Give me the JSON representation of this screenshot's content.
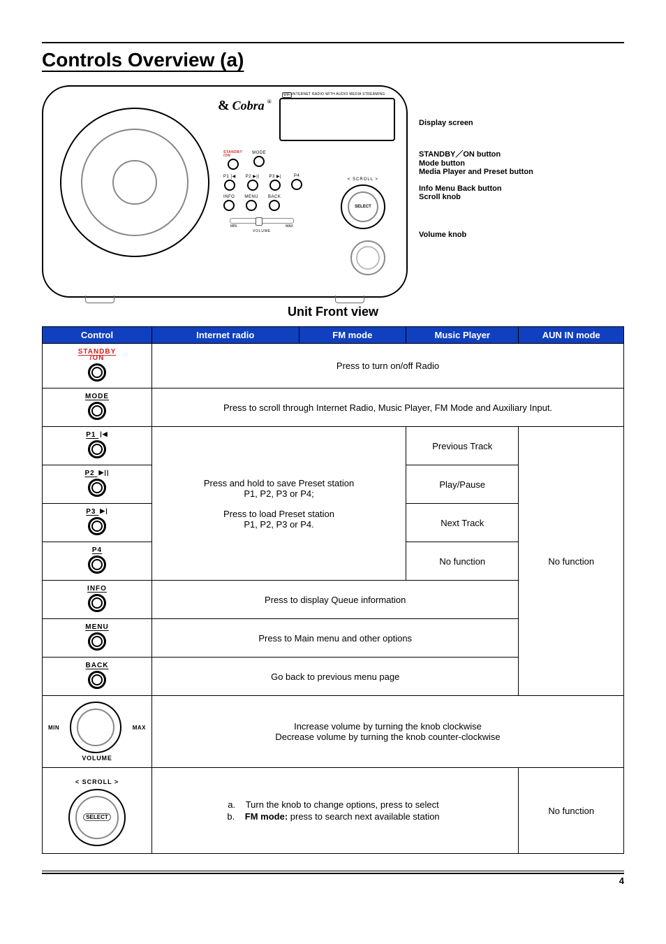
{
  "title": "Controls Overview (a)",
  "figure": {
    "brand": "Cobra",
    "brand_reg": "®",
    "screen_tag": "WiFi",
    "screen_caption": "INTERNET RADIO WITH AUDIO MEDIA STREAMING",
    "buttons_row1": [
      {
        "label": "STANDBY\n/ON",
        "red": true
      },
      {
        "label": "MODE"
      }
    ],
    "buttons_row2": [
      {
        "label": "P1 |◀"
      },
      {
        "label": "P2 ▶||"
      },
      {
        "label": "P3 ▶|"
      },
      {
        "label": "P4"
      }
    ],
    "buttons_row3": [
      {
        "label": "INFO"
      },
      {
        "label": "MENU"
      },
      {
        "label": "BACK"
      }
    ],
    "volume": {
      "min": "MIN",
      "max": "MAX",
      "label": "VOLUME"
    },
    "scroll": {
      "label": "< SCROLL >",
      "cap": "SELECT"
    }
  },
  "callouts": {
    "display": "Display screen",
    "standby": "STANDBY／ON button",
    "mode": "Mode button",
    "media": "Media Player and Preset button",
    "info_menu_back": "Info  Menu  Back button",
    "scroll": "Scroll knob",
    "volume": "Volume knob"
  },
  "caption": "Unit Front view",
  "columns": {
    "c1": "Control",
    "c2": "Internet radio",
    "c3": "FM mode",
    "c4": "Music Player",
    "c5": "AUN IN mode"
  },
  "rows": {
    "standby": {
      "label1": "STANDBY",
      "label2": "/ON",
      "desc": "Press to turn on/off Radio"
    },
    "mode": {
      "label": "MODE",
      "desc": "Press to scroll through Internet Radio, Music Player, FM Mode and Auxiliary Input."
    },
    "p1": {
      "label": "P1",
      "icon": "|◀",
      "music": "Previous Track"
    },
    "p2": {
      "label": "P2",
      "icon": "▶||",
      "music": "Play/Pause"
    },
    "p3": {
      "label": "P3",
      "icon": "▶|",
      "music": "Next Track"
    },
    "p4": {
      "label": "P4",
      "music": "No function"
    },
    "preset_desc_l1": "Press and hold to save Preset station",
    "preset_desc_l2": "P1, P2, P3 or P4;",
    "preset_desc_l3": "Press to load Preset station",
    "preset_desc_l4": "P1, P2, P3 or P4.",
    "aux_no_function": "No function",
    "info": {
      "label": "INFO",
      "desc": "Press to display Queue information"
    },
    "menu": {
      "label": "MENU",
      "desc": "Press to Main menu and other options"
    },
    "back": {
      "label": "BACK",
      "desc": "Go back to previous menu page"
    },
    "volume": {
      "min": "MIN",
      "max": "MAX",
      "label": "VOLUME",
      "l1": "Increase volume by turning the knob clockwise",
      "l2": "Decrease volume by turning the knob counter-clockwise"
    },
    "scroll": {
      "label": "< SCROLL >",
      "select": "SELECT",
      "a": "Turn the knob to change options, press to select",
      "b_prefix": "FM mode:",
      "b_rest": " press to search next available station",
      "aux": "No function"
    }
  },
  "page_no": "4"
}
